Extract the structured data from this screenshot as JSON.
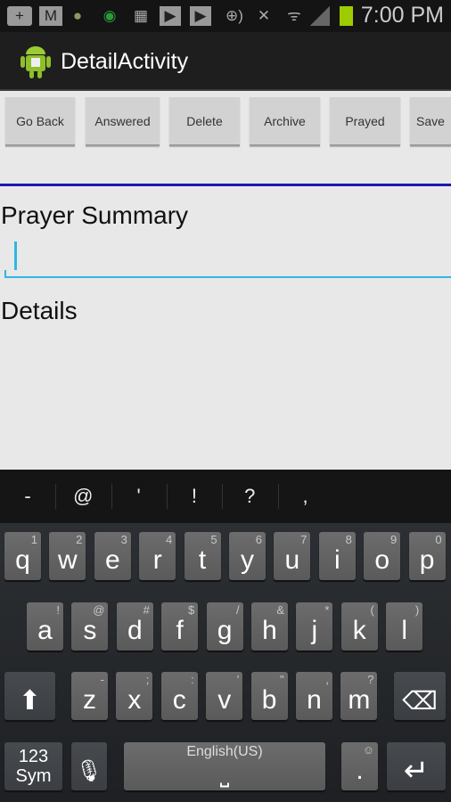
{
  "status_bar": {
    "time": "7:00 PM",
    "icons": [
      "add-icon",
      "gmail-icon",
      "android-icon",
      "shield-icon",
      "keyboard-icon",
      "play-store-icon",
      "play-store-icon",
      "nfc-icon",
      "mute-icon",
      "wifi-icon",
      "signal-icon",
      "battery-icon"
    ],
    "battery_color": "#9ccc00"
  },
  "action_bar": {
    "title": "DetailActivity"
  },
  "toolbar": {
    "buttons": [
      "Go Back",
      "Answered",
      "Delete",
      "Archive",
      "Prayed",
      "Save"
    ]
  },
  "form": {
    "summary_label": "Prayer Summary",
    "summary_value": "",
    "details_label": "Details"
  },
  "colors": {
    "accent": "#33b5e5",
    "divider": "#1a1aa8"
  },
  "keyboard": {
    "suggestions": [
      "-",
      "@",
      "'",
      "!",
      "?",
      ","
    ],
    "row1": [
      [
        "q",
        "1"
      ],
      [
        "w",
        "2"
      ],
      [
        "e",
        "3"
      ],
      [
        "r",
        "4"
      ],
      [
        "t",
        "5"
      ],
      [
        "y",
        "6"
      ],
      [
        "u",
        "7"
      ],
      [
        "i",
        "8"
      ],
      [
        "o",
        "9"
      ],
      [
        "p",
        "0"
      ]
    ],
    "row2": [
      [
        "a",
        "!"
      ],
      [
        "s",
        "@"
      ],
      [
        "d",
        "#"
      ],
      [
        "f",
        "$"
      ],
      [
        "g",
        "/"
      ],
      [
        "h",
        "&"
      ],
      [
        "j",
        "*"
      ],
      [
        "k",
        "("
      ],
      [
        "l",
        ")"
      ]
    ],
    "row3": [
      [
        "z",
        "-"
      ],
      [
        "x",
        ";"
      ],
      [
        "c",
        ":"
      ],
      [
        "v",
        "'"
      ],
      [
        "b",
        "\""
      ],
      [
        "n",
        ","
      ],
      [
        "m",
        "?"
      ]
    ],
    "sym_label": "123\nSym",
    "space_label": "English(US)",
    "period": "."
  }
}
